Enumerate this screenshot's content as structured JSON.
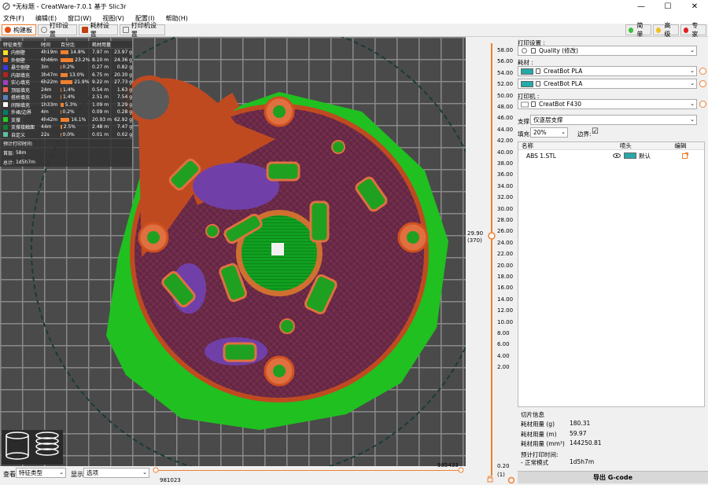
{
  "window": {
    "title": "*无标题 - CreatWare-7.0.1 基于 Slic3r",
    "minimize": "—",
    "maximize": "☐",
    "close": "✕"
  },
  "menu": [
    "文件(F)",
    "编辑(E)",
    "窗口(W)",
    "视图(V)",
    "配置(I)",
    "帮助(H)"
  ],
  "tabs": [
    {
      "label": "构建板",
      "active": true,
      "color": "#e05010"
    },
    {
      "label": "打印设置",
      "active": false,
      "color": "#888888"
    },
    {
      "label": "耗材设置",
      "active": false,
      "color": "#c04010"
    },
    {
      "label": "打印机设置",
      "active": false,
      "color": "#888888"
    }
  ],
  "modes": [
    {
      "label": "简单",
      "color": "#40c040"
    },
    {
      "label": "高级",
      "color": "#f0c020"
    },
    {
      "label": "专家",
      "color": "#e02020"
    }
  ],
  "legend": {
    "headers": [
      "特征类型",
      "时间",
      "百分比",
      "耗材用量"
    ],
    "rows": [
      {
        "name": "内侧壁",
        "time": "4h19m",
        "pct": "14.8%",
        "len": "7.97 m",
        "weight": "23.97 g",
        "color": "#f8e028",
        "bar": 0.148
      },
      {
        "name": "外侧壁",
        "time": "6h46m",
        "pct": "23.2%",
        "len": "8.10 m",
        "weight": "24.36 g",
        "color": "#f06818",
        "bar": 0.232
      },
      {
        "name": "悬空侧壁",
        "time": "3m",
        "pct": "0.2%",
        "len": "0.27 m",
        "weight": "0.82 g",
        "color": "#3838e0",
        "bar": 0.002
      },
      {
        "name": "内部填充",
        "time": "3h47m",
        "pct": "13.0%",
        "len": "6.75 m",
        "weight": "20.30 g",
        "color": "#b82020",
        "bar": 0.13
      },
      {
        "name": "实心填充",
        "time": "6h22m",
        "pct": "21.9%",
        "len": "9.22 m",
        "weight": "27.73 g",
        "color": "#a040c0",
        "bar": 0.219
      },
      {
        "name": "顶层填充",
        "time": "24m",
        "pct": "1.4%",
        "len": "0.54 m",
        "weight": "1.63 g",
        "color": "#f06050",
        "bar": 0.014
      },
      {
        "name": "搭桥填充",
        "time": "25m",
        "pct": "1.4%",
        "len": "2.51 m",
        "weight": "7.54 g",
        "color": "#5880c0",
        "bar": 0.014
      },
      {
        "name": "间隙填充",
        "time": "1h33m",
        "pct": "5.3%",
        "len": "1.09 m",
        "weight": "3.29 g",
        "color": "#ffffff",
        "bar": 0.053
      },
      {
        "name": "外裙/边界",
        "time": "4m",
        "pct": "0.2%",
        "len": "0.09 m",
        "weight": "0.28 g",
        "color": "#00806a",
        "bar": 0.002
      },
      {
        "name": "支撑",
        "time": "4h42m",
        "pct": "16.1%",
        "len": "20.93 m",
        "weight": "62.92 g",
        "color": "#20d020",
        "bar": 0.161
      },
      {
        "name": "支撑接触面",
        "time": "44m",
        "pct": "2.5%",
        "len": "2.48 m",
        "weight": "7.47 g",
        "color": "#108030",
        "bar": 0.025
      },
      {
        "name": "自定义",
        "time": "22s",
        "pct": "0.0%",
        "len": "0.01 m",
        "weight": "0.02 g",
        "color": "#5ec0a0",
        "bar": 0.0
      }
    ],
    "est_title": "预计打印时间:",
    "first_layer": "首层:",
    "first_layer_val": "58m",
    "total": "总计:",
    "total_val": "1d5h7m"
  },
  "vruler": {
    "ticks": [
      "58.00",
      "56.00",
      "54.00",
      "52.00",
      "50.00",
      "48.00",
      "46.00",
      "44.00",
      "42.00",
      "40.00",
      "38.00",
      "36.00",
      "34.00",
      "32.00",
      "30.00",
      "28.00",
      "26.00",
      "24.00",
      "22.00",
      "20.00",
      "18.00",
      "16.00",
      "14.00",
      "12.00",
      "10.00",
      "8.00",
      "6.00",
      "4.00",
      "2.00",
      "0.20"
    ],
    "current": "29.90",
    "current_layer": "(370)",
    "bottom_layer": "(1)"
  },
  "hslider": {
    "left": "981023",
    "right": "985433"
  },
  "bottom": {
    "view_label": "查看",
    "view_value": "特征类型",
    "show_label": "显示",
    "show_value": "选项"
  },
  "panel": {
    "print_settings_label": "打印设置 :",
    "print_settings_value": "Quality (修改)",
    "filament_label": "耗材 :",
    "filament1": "CreatBot PLA",
    "filament2": "CreatBot PLA",
    "printer_label": "打印机 :",
    "printer_value": "CreatBot F430",
    "support_label": "支撑:",
    "support_value": "仅逐层支撑",
    "infill_label": "填充:",
    "infill_value": "20%",
    "brim_label": "边界:",
    "brim_checked": "☑",
    "table_headers": [
      "名称",
      "喷头",
      "编辑"
    ],
    "object": {
      "name": "ABS 1.STL",
      "extruder": "默认",
      "color": "#2aa8a8"
    }
  },
  "slice_info": {
    "title": "切片信息",
    "rows": [
      {
        "k": "耗材用量 (g)",
        "v": "180.31"
      },
      {
        "k": "耗材用量 (m)",
        "v": "59.97"
      },
      {
        "k": "耗材用量 (mm³)",
        "v": "144250.81"
      }
    ],
    "est": "预计打印时间:",
    "mode": "- 正常模式",
    "mode_val": "1d5h7m"
  },
  "export_label": "导出 G-code"
}
